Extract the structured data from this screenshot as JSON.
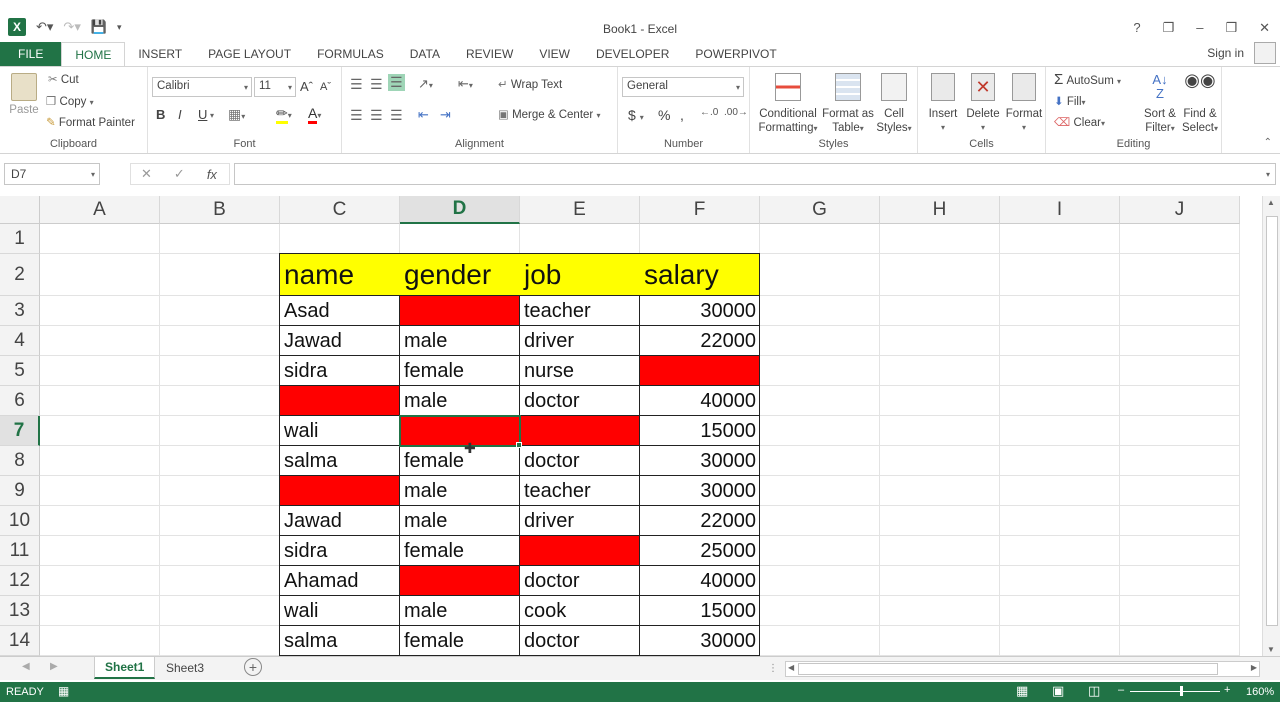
{
  "window": {
    "title": "Book1 - Excel",
    "help": "?",
    "controls": [
      "❐",
      "–",
      "❒",
      "✕"
    ]
  },
  "ribbon_tabs": [
    "FILE",
    "HOME",
    "INSERT",
    "PAGE LAYOUT",
    "FORMULAS",
    "DATA",
    "REVIEW",
    "VIEW",
    "DEVELOPER",
    "POWERPIVOT"
  ],
  "active_tab": "HOME",
  "signin": "Sign in",
  "clipboard": {
    "paste": "Paste",
    "cut": "Cut",
    "copy": "Copy",
    "format_painter": "Format Painter",
    "label": "Clipboard"
  },
  "font": {
    "name": "Calibri",
    "size": "11",
    "bold": "B",
    "italic": "I",
    "underline": "U",
    "label": "Font"
  },
  "alignment": {
    "wrap_text": "Wrap Text",
    "merge_center": "Merge & Center",
    "label": "Alignment"
  },
  "number": {
    "format": "General",
    "currency": "$",
    "percent": "%",
    "comma": ",",
    "label": "Number"
  },
  "styles": {
    "conditional_1": "Conditional",
    "conditional_2": "Formatting",
    "format_table_1": "Format as",
    "format_table_2": "Table",
    "cell_styles_1": "Cell",
    "cell_styles_2": "Styles",
    "label": "Styles"
  },
  "cells_group": {
    "insert": "Insert",
    "delete": "Delete",
    "format": "Format",
    "label": "Cells"
  },
  "editing": {
    "autosum": "AutoSum",
    "fill": "Fill",
    "clear": "Clear",
    "sort_1": "Sort &",
    "sort_2": "Filter",
    "find_1": "Find &",
    "find_2": "Select",
    "label": "Editing"
  },
  "formula_bar": {
    "name_box": "D7",
    "cancel": "✕",
    "enter": "✓",
    "fx": "fx",
    "value": ""
  },
  "grid": {
    "columns": [
      "A",
      "B",
      "C",
      "D",
      "E",
      "F",
      "G",
      "H",
      "I",
      "J"
    ],
    "selected_column": "D",
    "rows": [
      "1",
      "2",
      "3",
      "4",
      "5",
      "6",
      "7",
      "8",
      "9",
      "10",
      "11",
      "12",
      "13",
      "14"
    ],
    "selected_row": "7",
    "active_cell": "D7"
  },
  "table": {
    "headers": [
      "name",
      "gender",
      "job",
      "salary"
    ],
    "header_fill": "#ffff00",
    "missing_fill": "#ff0000",
    "rows": [
      [
        "Asad",
        "",
        "teacher",
        "30000"
      ],
      [
        "Jawad",
        "male",
        "driver",
        "22000"
      ],
      [
        "sidra",
        "female",
        "nurse",
        ""
      ],
      [
        "",
        "male",
        "doctor",
        "40000"
      ],
      [
        "wali",
        "",
        "",
        "15000"
      ],
      [
        "salma",
        "female",
        "doctor",
        "30000"
      ],
      [
        "",
        "male",
        "teacher",
        "30000"
      ],
      [
        "Jawad",
        "male",
        "driver",
        "22000"
      ],
      [
        "sidra",
        "female",
        "",
        "25000"
      ],
      [
        "Ahamad",
        "",
        "doctor",
        "40000"
      ],
      [
        "wali",
        "male",
        "cook",
        "15000"
      ],
      [
        "salma",
        "female",
        "doctor",
        "30000"
      ]
    ]
  },
  "sheets": [
    "Sheet1",
    "Sheet3"
  ],
  "active_sheet": "Sheet1",
  "status": {
    "ready": "READY",
    "zoom": "160%"
  },
  "colors": {
    "accent": "#217346"
  }
}
